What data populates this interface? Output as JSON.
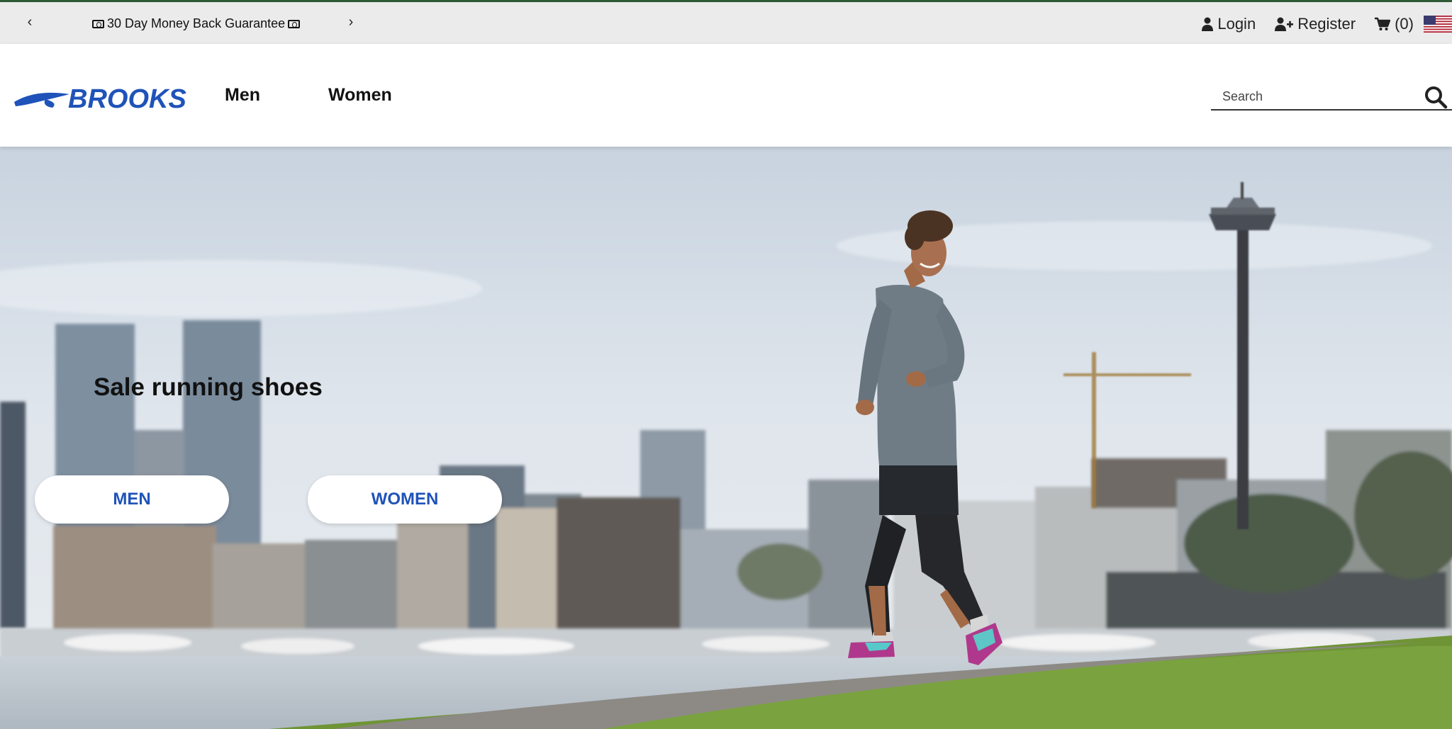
{
  "promo": {
    "text": "30 Day Money Back Guarantee",
    "prev_label": "‹",
    "next_label": "›"
  },
  "account": {
    "login": "Login",
    "register": "Register",
    "cart": "(0)"
  },
  "header": {
    "logo_text": "BROOKS",
    "nav": [
      {
        "label": "Men"
      },
      {
        "label": "Women"
      }
    ],
    "search_placeholder": "Search"
  },
  "hero": {
    "title": "Sale running shoes",
    "buttons": [
      {
        "label": "MEN"
      },
      {
        "label": "WOMEN"
      }
    ]
  },
  "colors": {
    "brand_blue": "#1f53b9",
    "topbar_bg": "#ebebeb",
    "top_border": "#2e5a36"
  }
}
